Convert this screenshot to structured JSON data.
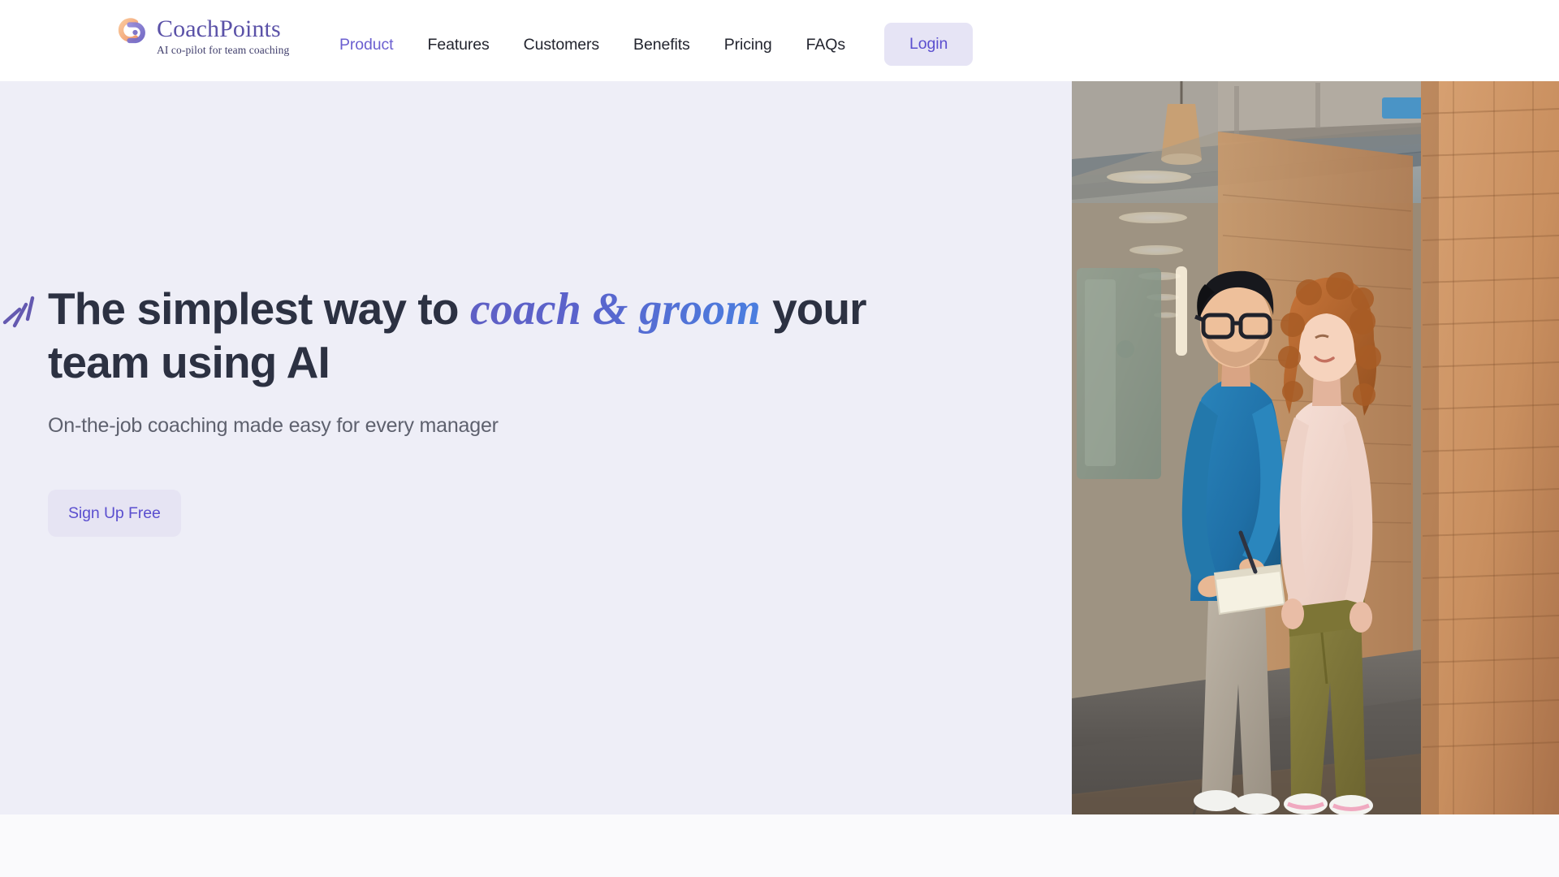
{
  "brand": {
    "name": "CoachPoints",
    "tagline": "AI co-pilot for team coaching",
    "logo_icon": "coachpoints-logo-icon",
    "name_color": "#5b52a8",
    "logo_arc_color": "#f5b183",
    "logo_p_color": "#5fb9c4"
  },
  "nav": {
    "items": [
      {
        "label": "Product",
        "active": true
      },
      {
        "label": "Features",
        "active": false
      },
      {
        "label": "Customers",
        "active": false
      },
      {
        "label": "Benefits",
        "active": false
      },
      {
        "label": "Pricing",
        "active": false
      },
      {
        "label": "FAQs",
        "active": false
      }
    ],
    "login_label": "Login"
  },
  "hero": {
    "title_part1": "The simplest way to ",
    "title_accent": "coach & groom",
    "title_part2": " your team using AI",
    "subtitle": "On-the-job coaching made easy for every manager",
    "cta_label": "Sign Up Free",
    "decoration_icon": "sparkle-lines-icon",
    "photo_alt": "Two colleagues walking and talking in a brick-walled office corridor, one writing on a notepad",
    "background_color": "#eeeef7",
    "accent_gradient_start": "#5f5fc4",
    "accent_gradient_end": "#4a7fe0",
    "button_bg": "#e6e4f3",
    "button_text_color": "#5b4fcf"
  },
  "page": {
    "below_fold_background": "#fafafc"
  }
}
